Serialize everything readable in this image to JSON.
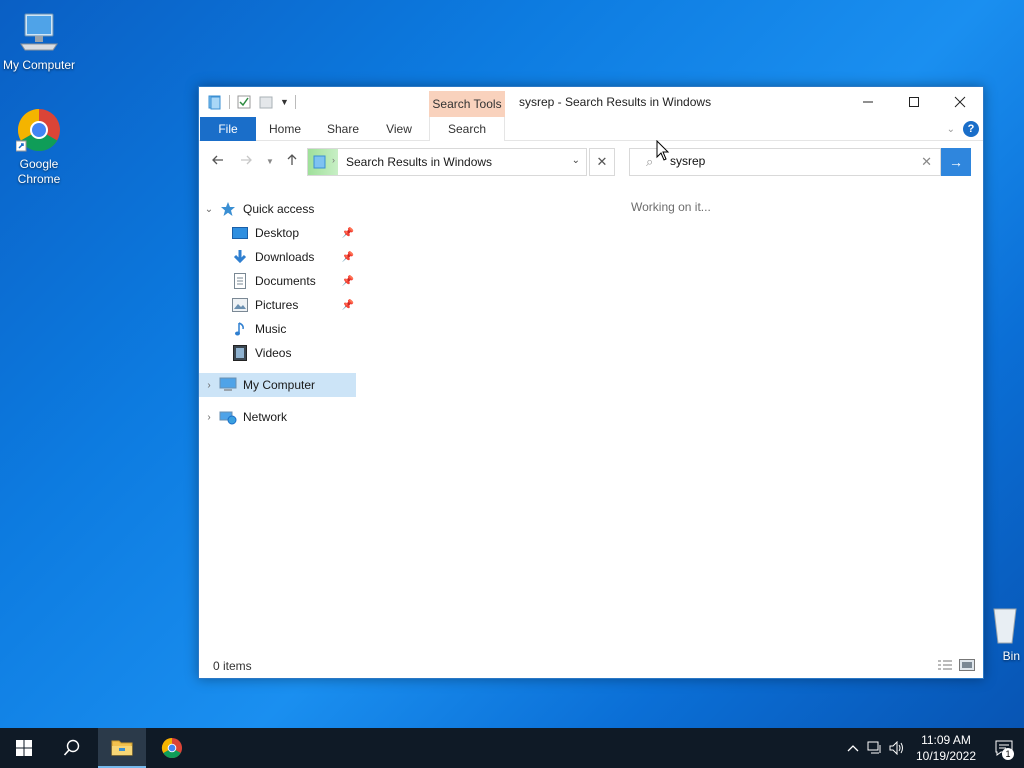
{
  "desktop": {
    "icons": [
      {
        "label": "My Computer"
      },
      {
        "label": "Google Chrome"
      },
      {
        "label": "Bin"
      }
    ]
  },
  "window": {
    "title": "sysrep - Search Results in Windows",
    "context_tab": "Search Tools",
    "ribbon_tabs": [
      "File",
      "Home",
      "Share",
      "View",
      "Search"
    ],
    "address": "Search Results in Windows",
    "search": {
      "value": "sysrep"
    },
    "status_message": "Working on it...",
    "status_count": "0 items",
    "nav_pane": {
      "quick_access": "Quick access",
      "items": [
        {
          "label": "Desktop",
          "pinned": true
        },
        {
          "label": "Downloads",
          "pinned": true
        },
        {
          "label": "Documents",
          "pinned": true
        },
        {
          "label": "Pictures",
          "pinned": true
        },
        {
          "label": "Music",
          "pinned": false
        },
        {
          "label": "Videos",
          "pinned": false
        }
      ],
      "my_computer": "My Computer",
      "network": "Network"
    }
  },
  "taskbar": {
    "time": "11:09 AM",
    "date": "10/19/2022",
    "notification_count": "1"
  },
  "colors": {
    "accent": "#1a6ec9",
    "context_tab": "#f9d2bd",
    "selection": "#cce4f7",
    "taskbar": "#0f1a26"
  }
}
